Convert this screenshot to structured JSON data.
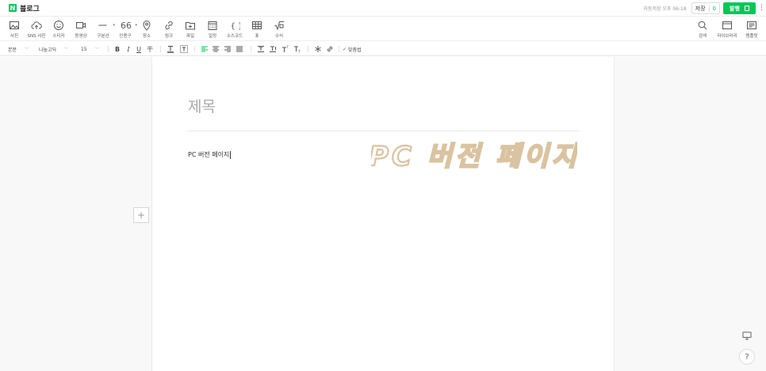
{
  "header": {
    "logo_letter": "N",
    "logo_text": "블로그",
    "autosave": "자동저장 오후 06:18",
    "save_label": "저장",
    "save_count": "0",
    "publish_label": "발행",
    "more": "⋮"
  },
  "toolbar": {
    "photo": "사진",
    "sns_photo": "SNS 사진",
    "sticker": "스티커",
    "video": "동영상",
    "divider": "구분선",
    "quote": "인용구",
    "place": "장소",
    "link": "링크",
    "file": "파일",
    "schedule": "일정",
    "source_code": "소스코드",
    "table": "표",
    "formula": "수식",
    "search": "검색",
    "library": "라이브러리",
    "template": "템플릿"
  },
  "formatbar": {
    "style": "본문",
    "font": "나눔고딕",
    "size": "15",
    "bold": "B",
    "italic": "I",
    "underline": "U",
    "strike": "干",
    "spellcheck": "맞춤법"
  },
  "document": {
    "title_placeholder": "제목",
    "body_text": "PC 버전 페이지",
    "watermark_text": "PC 버전 페이지"
  },
  "colors": {
    "brand": "#03c75a",
    "watermark": "#d9c3a0"
  },
  "floating": {
    "help": "?"
  }
}
